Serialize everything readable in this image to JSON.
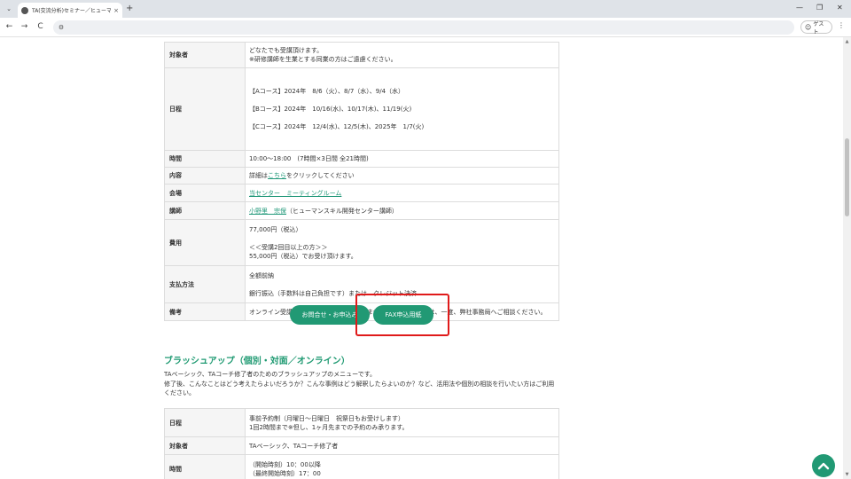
{
  "browser": {
    "tab_title": "TA(交流分析)セミナー／ヒューマンス",
    "tab_close": "×",
    "new_tab": "+",
    "menu_icon": "⌄",
    "back": "←",
    "forward": "→",
    "reload": "C",
    "site_info": "⚙",
    "profile_label": "ゲスト",
    "profile_icon": "☺",
    "kebab": "⋮",
    "minimize": "—",
    "maximize": "❐",
    "close": "✕"
  },
  "table1": {
    "target_label": "対象者",
    "target_line1": "どなたでも受講頂けます。",
    "target_line2": "※研修講師を生業とする同業の方はご遠慮ください。",
    "schedule_label": "日程",
    "schedule_a": "【Aコース】2024年　8/6（火）、8/7（水）、9/4（水）",
    "schedule_b": "【Bコース】2024年　10/16(水)、10/17(木)、11/19(火)",
    "schedule_c": "【Cコース】2024年　12/4(水)、12/5(木)、2025年　1/7(火)",
    "time_label": "時間",
    "time_value": "10:00～18:00　(7時間×3日間 全21時間)",
    "content_label": "内容",
    "content_prefix": "詳細は",
    "content_link": "こちら",
    "content_suffix": "をクリックしてください",
    "venue_label": "会場",
    "venue_link": "当センター　ミーティングルーム",
    "instructor_label": "講師",
    "instructor_link": "小野里　宗保",
    "instructor_suffix": "（ヒューマンスキル開発センター講師）",
    "fee_label": "費用",
    "fee_line1": "77,000円（税込）",
    "fee_line2": "＜＜受講2回目以上の方＞＞",
    "fee_line3": "55,000円（税込）でお受け頂けます。",
    "payment_label": "支払方法",
    "payment_line1": "全額前納",
    "payment_line2": "銀行振込（手数料は自己負担です）または　クレジット決済",
    "notes_label": "備考",
    "notes_value": "オンライン受講は基本的に受け付けておりませんが、ご希望の方は、一度、弊社事務局へご相談ください。"
  },
  "buttons": {
    "inquiry": "お問合せ・お申込み",
    "fax": "FAX申込用紙"
  },
  "section2": {
    "title": "ブラッシュアップ（個別・対面／オンライン）",
    "desc1": "TAベーシック、TAコーチ修了者のためのブラッシュアップのメニューです。",
    "desc2": "修了後、こんなことはどう考えたらよいだろうか？こんな事例はどう解釈したらよいのか？など、活用法や個別の相談を行いたい方はご利用ください。"
  },
  "table2": {
    "schedule_label": "日程",
    "schedule_line1": "事前予約制（月曜日～日曜日　祝祭日もお受けします）",
    "schedule_line2": "1回2時間まで※但し、1ヶ月先までの予約のみ承ります。",
    "target_label": "対象者",
    "target_value": "TAベーシック、TAコーチ修了者",
    "time_label": "時間",
    "time_line1": "（開始時刻）10：00以降",
    "time_line2": "（最終開始時刻）17：00"
  },
  "colors": {
    "accent": "#219974",
    "highlight": "#e01a1a"
  }
}
